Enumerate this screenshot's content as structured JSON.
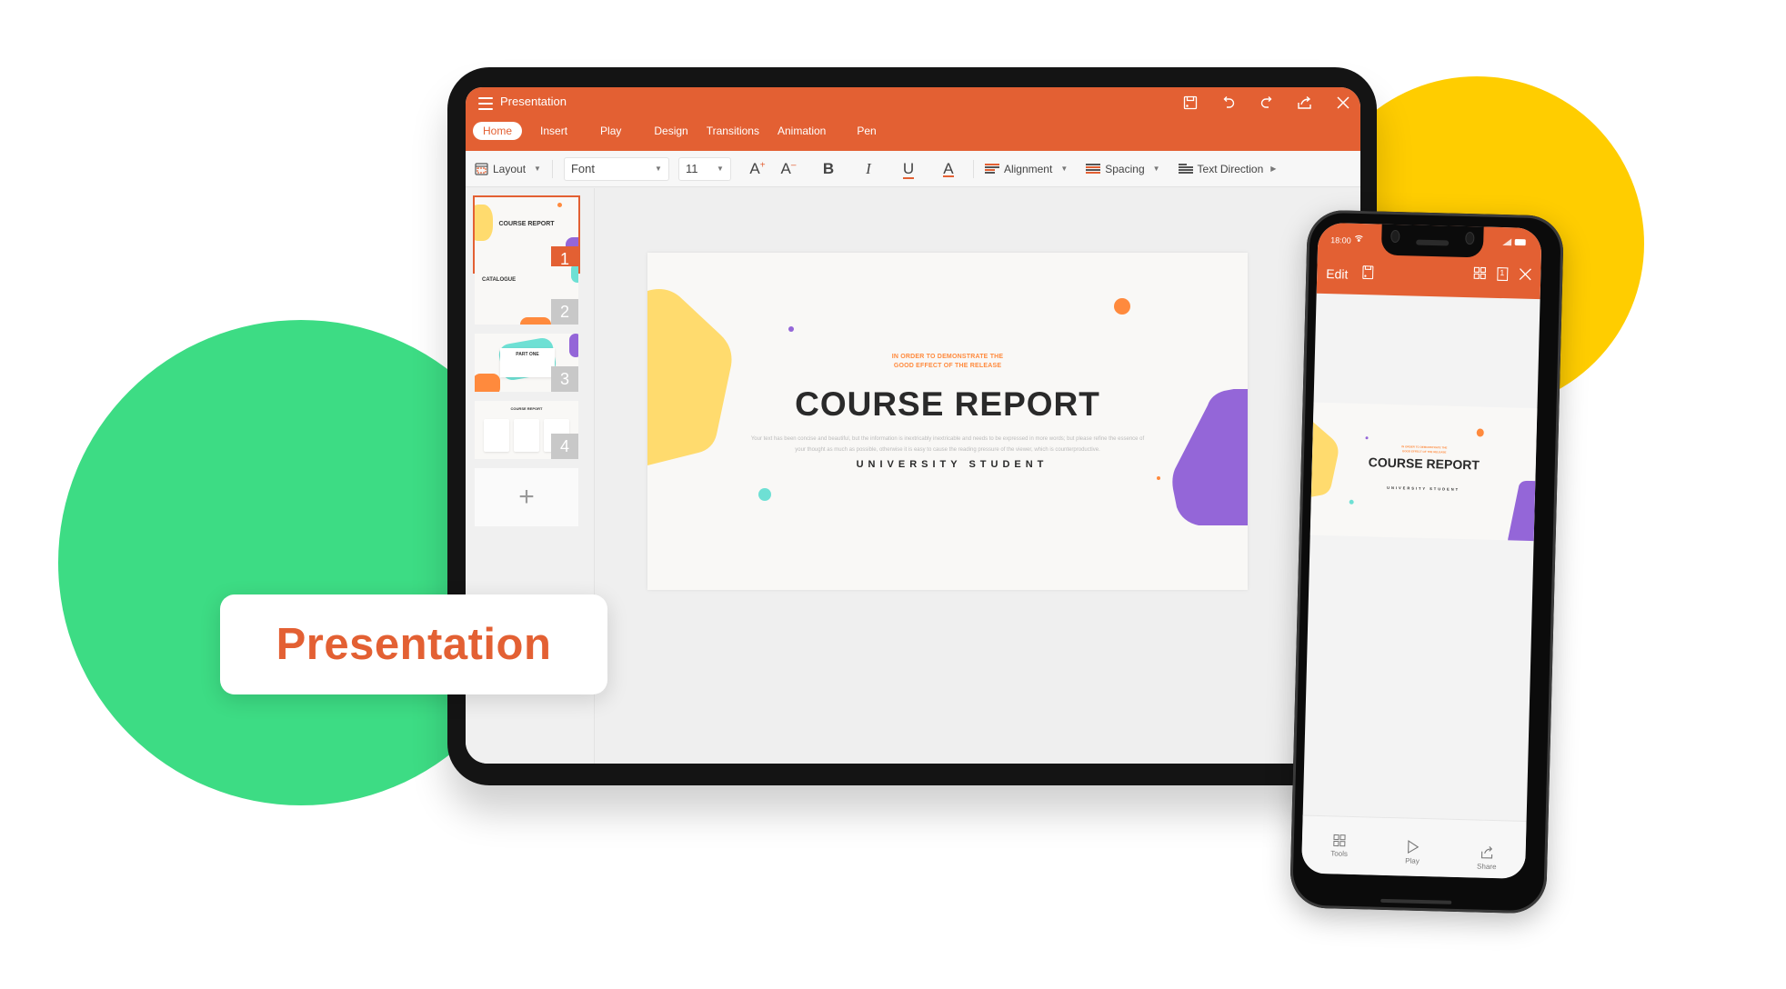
{
  "colors": {
    "brand": "#e36033",
    "green": "#3ddc84",
    "yellow": "#ffcd00",
    "slide_yellow": "#ffdb6e",
    "slide_purple": "#9466d8",
    "slide_orange": "#ff8a3d",
    "slide_teal": "#6ee0d4"
  },
  "tablet": {
    "app_title": "Presentation",
    "title_icons": [
      "save-icon",
      "undo-icon",
      "redo-icon",
      "share-icon",
      "close-icon"
    ],
    "tabs": [
      {
        "label": "Home",
        "active": true
      },
      {
        "label": "Insert"
      },
      {
        "label": "Play"
      },
      {
        "label": "Design"
      },
      {
        "label": "Transitions"
      },
      {
        "label": "Animation"
      },
      {
        "label": "Pen"
      }
    ],
    "toolbar": {
      "layout_label": "Layout",
      "font_value": "Font",
      "size_value": "11",
      "increase_font": "A",
      "decrease_font": "A",
      "bold": "B",
      "italic": "I",
      "underline": "U",
      "font_color": "A",
      "alignment_label": "Alignment",
      "spacing_label": "Spacing",
      "text_direction_label": "Text Direction"
    },
    "thumbnails": [
      {
        "number": "1",
        "title": "COURSE REPORT",
        "selected": true
      },
      {
        "number": "2",
        "title": "CATALOGUE"
      },
      {
        "number": "3",
        "title": "PART ONE"
      },
      {
        "number": "4",
        "title": "COURSE REPORT"
      }
    ],
    "add_slide": "+",
    "slide": {
      "kicker_line1": "IN ORDER TO DEMONSTRATE THE",
      "kicker_line2": "GOOD EFFECT OF THE RELEASE",
      "title": "COURSE REPORT",
      "body": "Your text has been concise and beautiful, but the information is inextricably inextricable and needs to be expressed in more words; but please refine the essence of your thought as much as possible, otherwise it is easy to cause the reading pressure of the viewer, which is counterproductive.",
      "subtitle": "UNIVERSITY STUDENT"
    }
  },
  "label_card": "Presentation",
  "phone": {
    "time": "18:00",
    "edit_label": "Edit",
    "top_icons": [
      "save-icon",
      "grid-icon",
      "page-icon",
      "close-icon"
    ],
    "page_number": "1",
    "slide": {
      "kicker_line1": "IN ORDER TO DEMONSTRATE THE",
      "kicker_line2": "GOOD EFFECT OF THE RELEASE",
      "title": "COURSE REPORT",
      "subtitle": "UNIVERSITY STUDENT"
    },
    "bottom_bar": [
      {
        "label": "Tools",
        "icon": "grid-icon"
      },
      {
        "label": "Play",
        "icon": "play-icon"
      },
      {
        "label": "Share",
        "icon": "share-icon"
      }
    ]
  }
}
